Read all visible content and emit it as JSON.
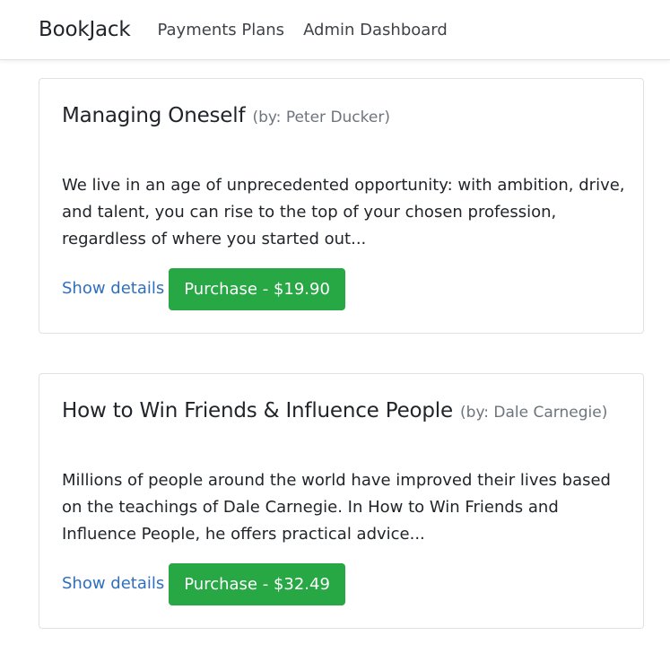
{
  "navbar": {
    "brand": "BookJack",
    "links": [
      "Payments Plans",
      "Admin Dashboard"
    ]
  },
  "books": [
    {
      "title": "Managing Oneself",
      "author": "(by: Peter Ducker)",
      "description": "We live in an age of unprecedented opportunity: with ambition, drive, and talent, you can rise to the top of your chosen profession, regardless of where you started out...",
      "details_label": "Show details",
      "purchase_label": "Purchase - $19.90"
    },
    {
      "title": "How to Win Friends & Influence People",
      "author": "(by: Dale Carnegie)",
      "description": "Millions of people around the world have improved their lives based on the teachings of Dale Carnegie. In How to Win Friends and Influence People, he offers practical advice...",
      "details_label": "Show details",
      "purchase_label": "Purchase - $32.49"
    }
  ],
  "colors": {
    "accent_green": "#28a745",
    "link_blue": "#2f6fbd",
    "muted_gray": "#6c757d"
  }
}
